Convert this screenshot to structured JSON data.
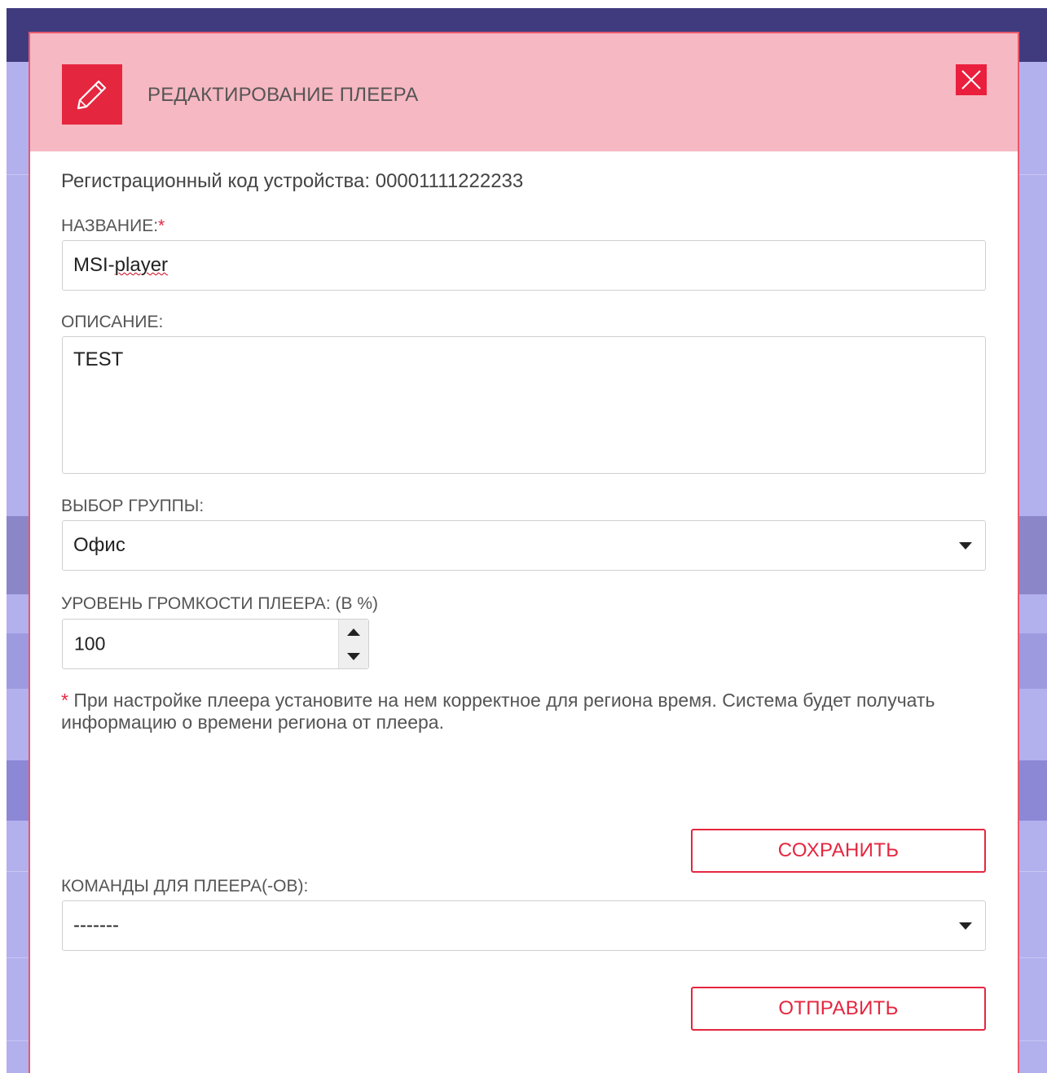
{
  "modal": {
    "title": "РЕДАКТИРОВАНИЕ ПЛЕЕРА",
    "icon": "pencil-icon",
    "close_icon": "close-icon"
  },
  "registration": {
    "text": "Регистрационный код устройства: 00001111222233"
  },
  "name_field": {
    "label": "НАЗВАНИЕ:",
    "required_mark": "*",
    "value_prefix": "MSI-",
    "value_misspelled": "player"
  },
  "description_field": {
    "label": "ОПИСАНИЕ:",
    "value": "TEST"
  },
  "group_field": {
    "label": "ВЫБОР ГРУППЫ:",
    "selected": "Офис"
  },
  "volume_field": {
    "label": "УРОВЕНЬ ГРОМКОСТИ ПЛЕЕРА: (В %)",
    "value": "100"
  },
  "note": {
    "star": "*",
    "text": " При настройке плеера установите на нем корректное для региона время. Система будет получать информацию о времени региона от плеера."
  },
  "buttons": {
    "save": "СОХРАНИТЬ",
    "send": "ОТПРАВИТЬ"
  },
  "commands_field": {
    "label": "КОМАНДЫ ДЛЯ ПЛЕЕРА(-ОВ):",
    "selected": "-------"
  },
  "colors": {
    "accent": "#e5263f",
    "header_bg": "#f6b8c2",
    "backdrop": "#b3b0ee",
    "topbar": "#3f3b7e"
  }
}
